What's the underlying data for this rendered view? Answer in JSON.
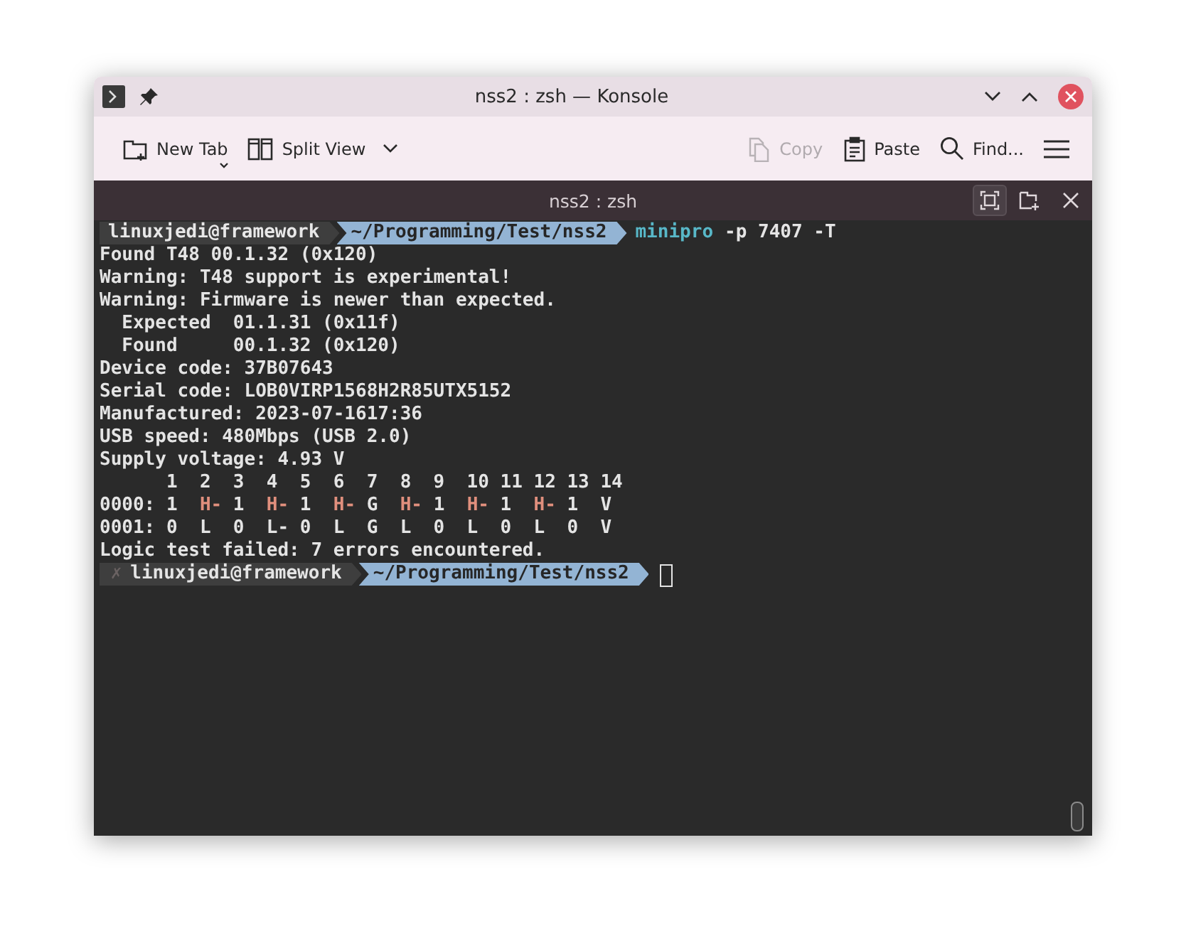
{
  "window": {
    "title": "nss2 : zsh — Konsole"
  },
  "toolbar": [
    {
      "kind": "new-tab",
      "label": "New Tab",
      "disabled": false
    },
    {
      "kind": "split-view",
      "label": "Split View",
      "disabled": false
    },
    {
      "kind": "copy",
      "label": "Copy",
      "disabled": true
    },
    {
      "kind": "paste",
      "label": "Paste",
      "disabled": false
    },
    {
      "kind": "find",
      "label": "Find...",
      "disabled": false
    },
    {
      "kind": "menu",
      "disabled": false
    }
  ],
  "tab": {
    "title": "nss2 : zsh"
  },
  "terminal": {
    "lines": [
      {
        "kind": "prompt",
        "user": "linuxjedi@framework",
        "path": "~/Programming/Test/nss2",
        "command": "minipro",
        "args": "-p 7407 -T",
        "cursor": false
      },
      {
        "kind": "output",
        "segments": [
          {
            "text": "Found T48 00.1.32 (0x120)",
            "error": false
          }
        ]
      },
      {
        "kind": "output",
        "segments": [
          {
            "text": "Warning: T48 support is experimental!",
            "error": false
          }
        ]
      },
      {
        "kind": "output",
        "segments": [
          {
            "text": "Warning: Firmware is newer than expected.",
            "error": false
          }
        ]
      },
      {
        "kind": "output",
        "segments": [
          {
            "text": "  Expected  01.1.31 (0x11f)",
            "error": false
          }
        ]
      },
      {
        "kind": "output",
        "segments": [
          {
            "text": "  Found     00.1.32 (0x120)",
            "error": false
          }
        ]
      },
      {
        "kind": "output",
        "segments": [
          {
            "text": "Device code: 37B07643",
            "error": false
          }
        ]
      },
      {
        "kind": "output",
        "segments": [
          {
            "text": "Serial code: LOB0VIRP1568H2R85UTX5152",
            "error": false
          }
        ]
      },
      {
        "kind": "output",
        "segments": [
          {
            "text": "Manufactured: 2023-07-1617:36",
            "error": false
          }
        ]
      },
      {
        "kind": "output",
        "segments": [
          {
            "text": "USB speed: 480Mbps (USB 2.0)",
            "error": false
          }
        ]
      },
      {
        "kind": "output",
        "segments": [
          {
            "text": "Supply voltage: 4.93 V",
            "error": false
          }
        ]
      },
      {
        "kind": "output",
        "segments": [
          {
            "text": "      1  2  3  4  5  6  7  8  9  10 11 12 13 14",
            "error": false
          }
        ]
      },
      {
        "kind": "output",
        "segments": [
          {
            "text": "0000: 1  ",
            "error": false
          },
          {
            "text": "H-",
            "error": true
          },
          {
            "text": " 1  ",
            "error": false
          },
          {
            "text": "H-",
            "error": true
          },
          {
            "text": " 1  ",
            "error": false
          },
          {
            "text": "H-",
            "error": true
          },
          {
            "text": " G  ",
            "error": false
          },
          {
            "text": "H-",
            "error": true
          },
          {
            "text": " 1  ",
            "error": false
          },
          {
            "text": "H-",
            "error": true
          },
          {
            "text": " 1  ",
            "error": false
          },
          {
            "text": "H-",
            "error": true
          },
          {
            "text": " 1  V",
            "error": false
          }
        ]
      },
      {
        "kind": "output",
        "segments": [
          {
            "text": "0001: 0  L  0  L- 0  L  G  L  0  L  0  L  0  V",
            "error": false
          }
        ]
      },
      {
        "kind": "output",
        "segments": [
          {
            "text": "Logic test failed: 7 errors encountered.",
            "error": false
          }
        ]
      },
      {
        "kind": "prompt",
        "status": "✗",
        "user": "linuxjedi@framework",
        "path": "~/Programming/Test/nss2",
        "cursor": true
      }
    ]
  }
}
